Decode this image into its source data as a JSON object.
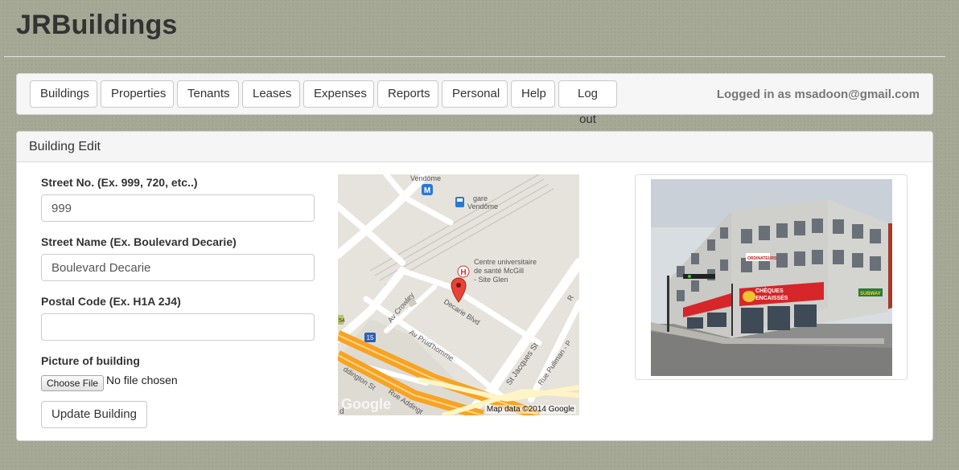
{
  "app": {
    "title": "JRBuildings"
  },
  "nav": {
    "items": [
      "Buildings",
      "Properties",
      "Tenants",
      "Leases",
      "Expenses",
      "Reports",
      "Personal",
      "Help",
      "Log out"
    ],
    "logged_in_text": "Logged in as msadoon@gmail.com"
  },
  "panel": {
    "title": "Building Edit",
    "street_no": {
      "label": "Street No. (Ex. 999, 720, etc..)",
      "value": "999"
    },
    "street_name": {
      "label": "Street Name (Ex. Boulevard Decarie)",
      "value": "Boulevard Decarie"
    },
    "postal_code": {
      "label": "Postal Code (Ex. H1A 2J4)",
      "value": ""
    },
    "picture": {
      "label": "Picture of building",
      "button_label": "Choose File",
      "status": "No file chosen"
    },
    "submit_label": "Update Building"
  },
  "map": {
    "labels": {
      "metro_station": "Vendôme",
      "gare_line1": "gare",
      "gare_line2": "Vendôme",
      "hospital_line1": "Centre universitaire",
      "hospital_line2": "de santé McGill",
      "hospital_line3": "- Site Glen",
      "street_crowley": "Av Crowley",
      "street_decarie": "Decarie Blvd",
      "street_prudhomme": "Av Prud'homme",
      "street_st_jacques": "St Jacques St",
      "street_pullman": "Rue Pullman - P",
      "street_addington": "Rue Addingt",
      "street_addington_st": "ddington St",
      "highway_shield": "15",
      "shield_54": "54",
      "metro_icon_letter": "M",
      "hospital_icon_letter": "H",
      "edge_r": "R",
      "edge_d": "d",
      "google_logo": "Google"
    },
    "attribution": "Map data ©2014 Google"
  },
  "photo": {
    "signs": {
      "cheques": "CHÈQUES",
      "encaisses": "ENCAISSÉS",
      "ordinateurs": "ORDINATEURS",
      "subway": "SUBWAY"
    }
  }
}
